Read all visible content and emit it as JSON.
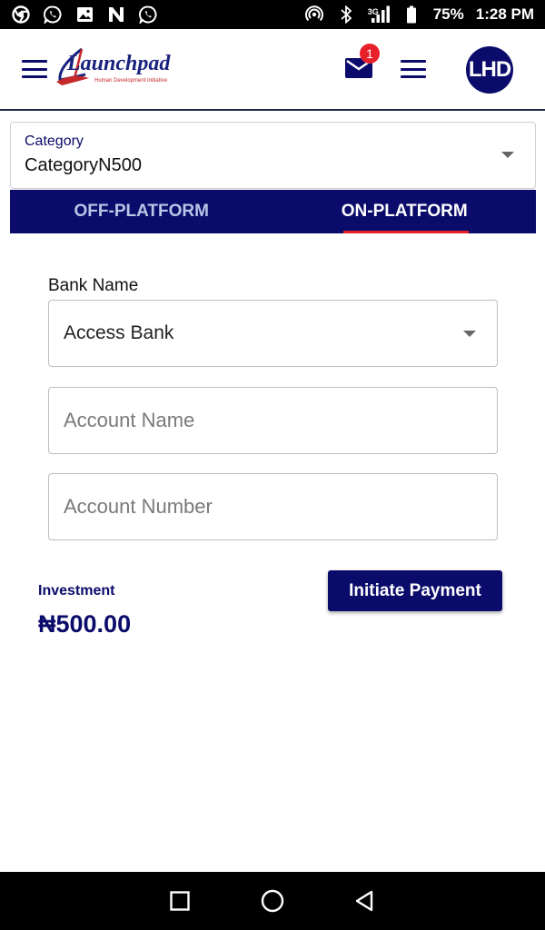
{
  "status_bar": {
    "network": "3G",
    "battery": "75%",
    "time": "1:28 PM",
    "left_icons": [
      "chrome-icon",
      "whatsapp-icon",
      "gallery-icon",
      "n-icon",
      "whatsapp-icon"
    ]
  },
  "header": {
    "logo_text": "Launchpad",
    "logo_subtitle": "Human Development Initiative",
    "mail_badge": "1",
    "avatar_initials": "LHD"
  },
  "category": {
    "label": "Category",
    "value": "CategoryN500"
  },
  "tabs": [
    {
      "label": "OFF-PLATFORM",
      "active": false
    },
    {
      "label": "ON-PLATFORM",
      "active": true
    }
  ],
  "form": {
    "bank_label": "Bank Name",
    "bank_value": "Access Bank",
    "account_name_placeholder": "Account Name",
    "account_number_placeholder": "Account Number"
  },
  "investment": {
    "label": "Investment",
    "value": "₦500.00"
  },
  "actions": {
    "initiate_payment": "Initiate Payment"
  },
  "colors": {
    "primary": "#0b0b6b",
    "accent": "#e8202a"
  }
}
